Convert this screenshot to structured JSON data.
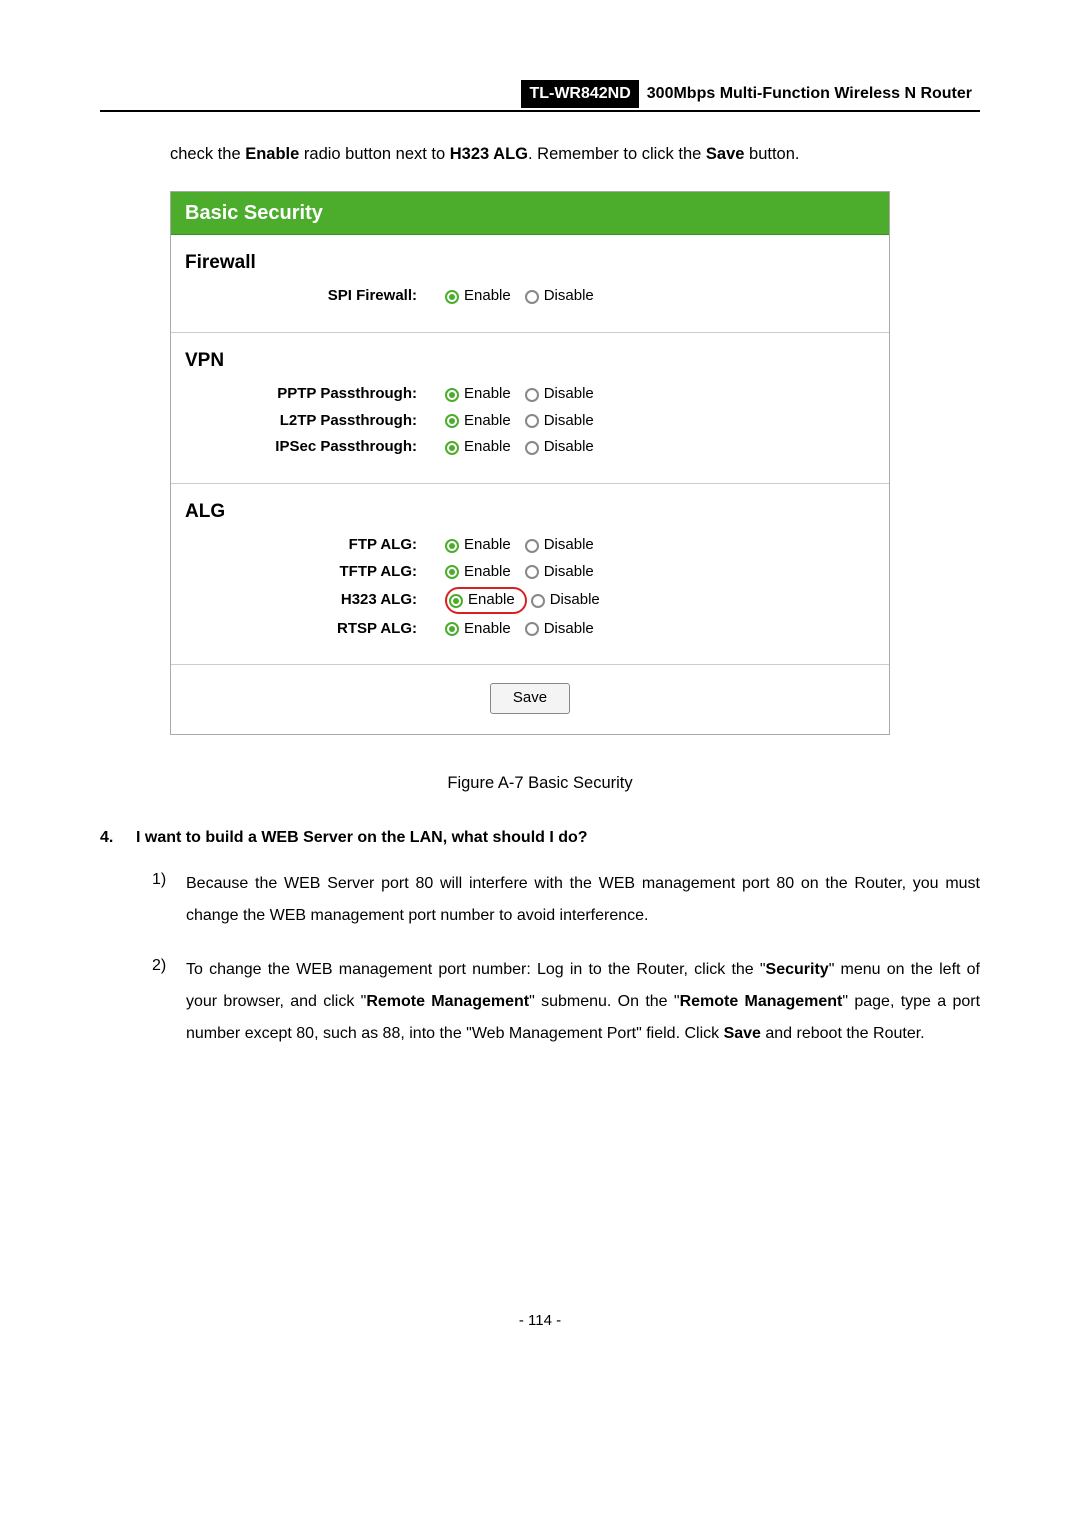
{
  "header": {
    "model": "TL-WR842ND",
    "title": "300Mbps Multi-Function Wireless N Router"
  },
  "intro": {
    "pre": "check the ",
    "b1": "Enable",
    "mid1": " radio button next to ",
    "b2": "H323 ALG",
    "mid2": ". Remember to click the ",
    "b3": "Save",
    "post": " button."
  },
  "panel": {
    "title": "Basic Security",
    "enable": "Enable",
    "disable": "Disable",
    "firewall": {
      "heading": "Firewall",
      "spi": "SPI Firewall:"
    },
    "vpn": {
      "heading": "VPN",
      "pptp": "PPTP Passthrough:",
      "l2tp": "L2TP Passthrough:",
      "ipsec": "IPSec Passthrough:"
    },
    "alg": {
      "heading": "ALG",
      "ftp": "FTP ALG:",
      "tftp": "TFTP ALG:",
      "h323": "H323 ALG:",
      "rtsp": "RTSP ALG:"
    },
    "save": "Save"
  },
  "caption": "Figure A-7    Basic Security",
  "q4": {
    "num": "4.",
    "text": "I want to build a WEB Server on the LAN, what should I do?"
  },
  "steps": {
    "s1": {
      "num": "1)",
      "text": "Because the WEB Server port 80 will interfere with the WEB management port 80 on the Router, you must change the WEB management port number to avoid interference."
    },
    "s2": {
      "num": "2)",
      "p1": "To change the WEB management port number: Log in to the Router, click the \"",
      "b1": "Security",
      "p2": "\" menu on the left of your browser, and click \"",
      "b2": "Remote Management",
      "p3": "\" submenu. On the \"",
      "b3": "Remote Management",
      "p4": "\" page, type a port number except 80, such as 88, into the \"Web Management Port\" field. Click ",
      "b4": "Save",
      "p5": " and reboot the Router."
    }
  },
  "pagenum": "- 114 -"
}
